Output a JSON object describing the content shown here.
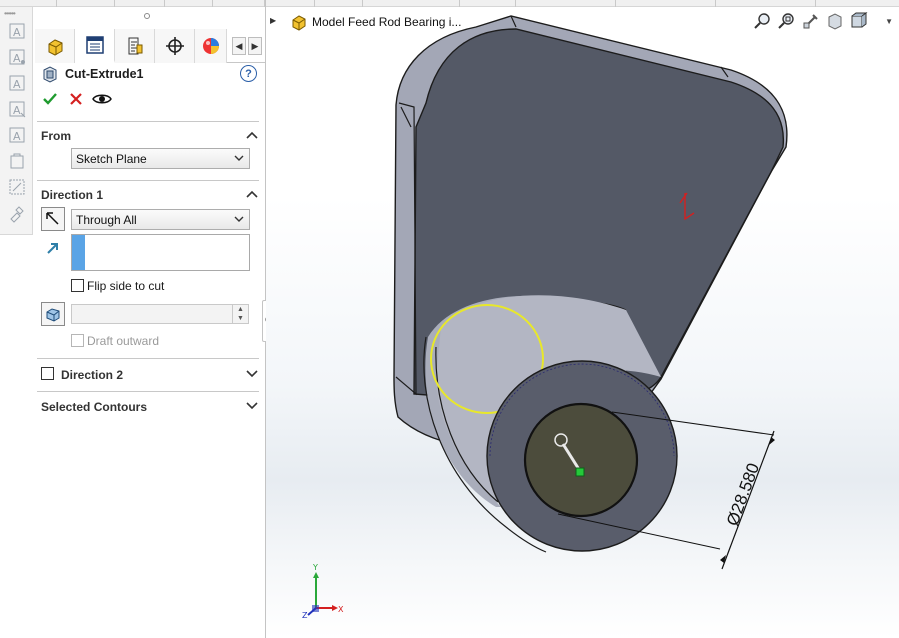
{
  "feature": {
    "title": "Cut-Extrude1",
    "help_icon": "?"
  },
  "sections": {
    "from": {
      "title": "From",
      "start_condition": "Sketch Plane"
    },
    "direction1": {
      "title": "Direction 1",
      "end_condition": "Through All",
      "flip_side_label": "Flip side to cut",
      "flip_side_checked": false,
      "draft_value": "",
      "draft_outward_label": "Draft outward",
      "draft_outward_checked": false
    },
    "direction2": {
      "title": "Direction 2",
      "checked": false
    },
    "selected_contours": {
      "title": "Selected Contours"
    }
  },
  "tabs": [
    {
      "name": "feature-manager",
      "icon": "part-icon"
    },
    {
      "name": "property-manager",
      "icon": "property-manager-icon"
    },
    {
      "name": "configuration-manager",
      "icon": "configuration-icon"
    },
    {
      "name": "dimxpert-manager",
      "icon": "crosshair-icon"
    },
    {
      "name": "display-manager",
      "icon": "appearance-ball-icon"
    }
  ],
  "viewport": {
    "tree_label": "Model Feed Rod Bearing i...",
    "dimension_text": "Ø28.580"
  },
  "colors": {
    "accept_green": "#1f9b2f",
    "cancel_red": "#d42020",
    "selection_yellow": "#e8e82a",
    "model_face": "#545966",
    "model_side": "#a3a7b6",
    "entity_blue": "#5aa4e6"
  }
}
